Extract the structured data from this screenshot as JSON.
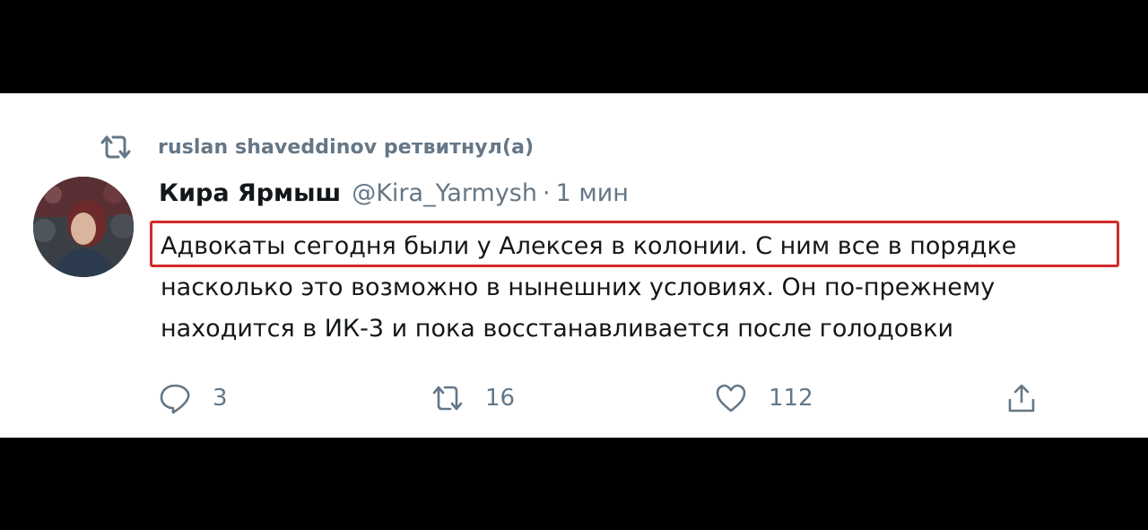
{
  "retweet": {
    "label": "ruslan shaveddinov ретвитнул(а)",
    "icon": "retweet-icon"
  },
  "author": {
    "name": "Кира Ярмыш",
    "handle": "@Kira_Yarmysh",
    "separator": "·",
    "time": "1 мин"
  },
  "tweet": {
    "lines": [
      "Адвокаты сегодня были у Алексея в колонии. С ним все в порядке",
      "насколько это возможно в нынешних условиях. Он по-прежнему",
      "находится в ИК-3 и пока восстанавливается после голодовки"
    ],
    "highlight_color": "#d42a2a"
  },
  "actions": {
    "replies": "3",
    "retweets": "16",
    "likes": "112",
    "icons": [
      "reply-icon",
      "retweet-icon",
      "like-icon",
      "share-icon"
    ]
  },
  "colors": {
    "text": "#14171a",
    "muted": "#657786",
    "background": "#ffffff",
    "frame": "#000000"
  }
}
